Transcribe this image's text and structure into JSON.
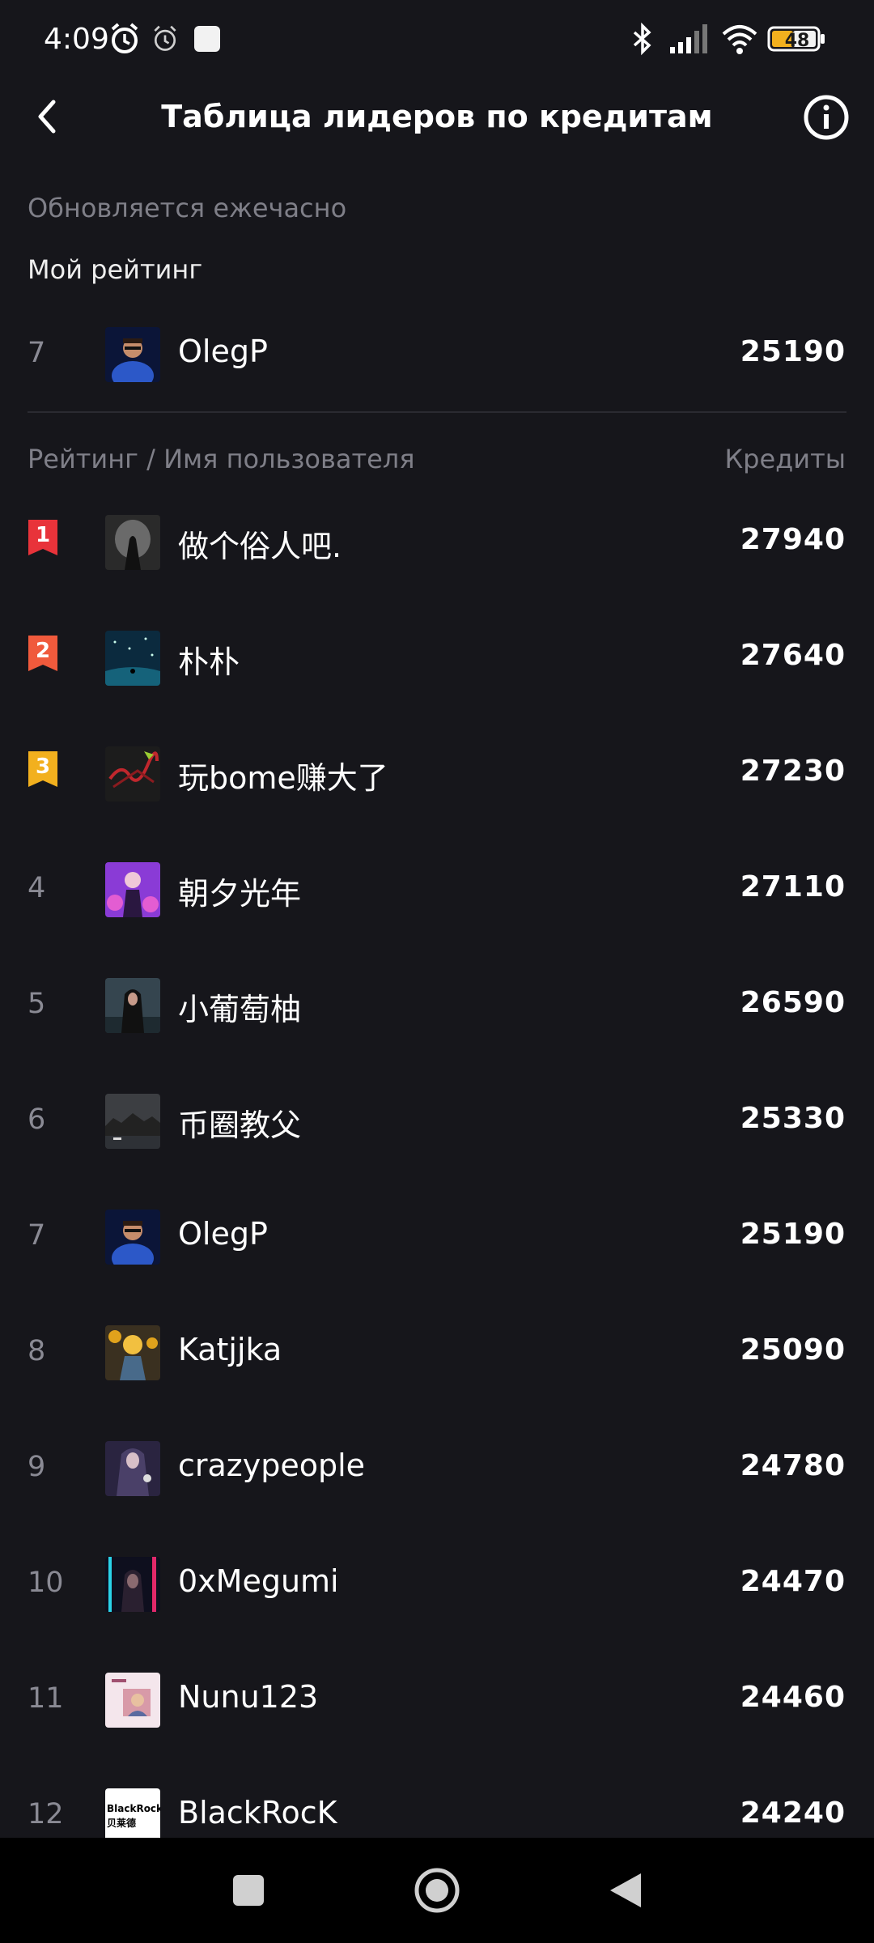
{
  "status_bar": {
    "time": "4:09",
    "battery": "48",
    "icons": [
      "alarm-icon",
      "alarm-outline-icon",
      "notification-icon",
      "bluetooth-icon",
      "signal-icon",
      "wifi-icon",
      "battery-icon"
    ]
  },
  "header": {
    "title": "Таблица лидеров по кредитам",
    "back_icon": "back-chevron-icon",
    "info_icon": "info-icon"
  },
  "update_note": "Обновляется ежечасно",
  "my_rating": {
    "label": "Мой рейтинг",
    "rank": "7",
    "name": "OlegP",
    "credits": "25190"
  },
  "columns": {
    "left": "Рейтинг / Имя пользователя",
    "right": "Кредиты"
  },
  "colors": {
    "background": "#16161b",
    "gold": "#f2b01e",
    "silver": "#f05a3c",
    "first": "#e8333a"
  },
  "leaderboard": [
    {
      "rank": "1",
      "name": "做个俗人吧.",
      "credits": "27940"
    },
    {
      "rank": "2",
      "name": "朴朴",
      "credits": "27640"
    },
    {
      "rank": "3",
      "name": "玩bome赚大了",
      "credits": "27230"
    },
    {
      "rank": "4",
      "name": "朝夕光年",
      "credits": "27110"
    },
    {
      "rank": "5",
      "name": "小葡萄柚",
      "credits": "26590"
    },
    {
      "rank": "6",
      "name": "币圈教父",
      "credits": "25330"
    },
    {
      "rank": "7",
      "name": "OlegP",
      "credits": "25190"
    },
    {
      "rank": "8",
      "name": "Katjjka",
      "credits": "25090"
    },
    {
      "rank": "9",
      "name": "crazypeople",
      "credits": "24780"
    },
    {
      "rank": "10",
      "name": "0xMegumi",
      "credits": "24470"
    },
    {
      "rank": "11",
      "name": "Nunu123",
      "credits": "24460"
    },
    {
      "rank": "12",
      "name": "BlackRocK",
      "credits": "24240"
    }
  ],
  "avatar_logo_text": [
    "BlackRock",
    "贝莱德"
  ]
}
